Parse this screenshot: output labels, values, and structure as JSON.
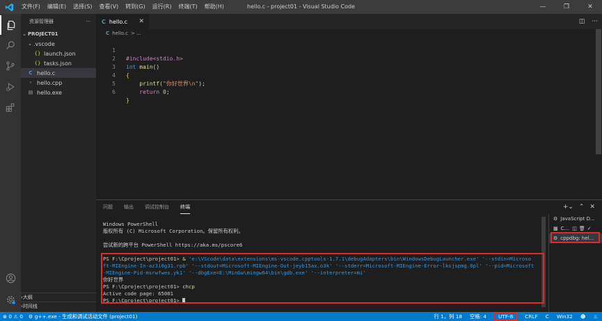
{
  "titlebar": {
    "title": "hello.c - project01 - Visual Studio Code",
    "menu": [
      "文件(F)",
      "编辑(E)",
      "选择(S)",
      "查看(V)",
      "转到(G)",
      "运行(R)",
      "终端(T)",
      "帮助(H)"
    ]
  },
  "activity": [
    "files-icon",
    "search-icon",
    "source-control-icon",
    "run-debug-icon",
    "extensions-icon",
    "account-icon",
    "settings-gear-icon"
  ],
  "explorer": {
    "header": "资源管理器",
    "more": "···",
    "project": "PROJECT01",
    "vscode_folder": ".vscode",
    "launch": "launch.json",
    "tasks": "tasks.json",
    "hello_c": "hello.c",
    "hello_cpp": "hello.cpp",
    "hello_exe": "hello.exe",
    "json_icon": "{}",
    "c_icon": "C",
    "outline": "大纲",
    "timeline": "时间线"
  },
  "editor": {
    "tab_icon": "C",
    "tab_label": "hello.c",
    "breadcrumb_icon": "C",
    "breadcrumb_file": "hello.c",
    "breadcrumb_sep": "> ...",
    "lines": {
      "l1": {
        "n": "1",
        "pre": "#include<stdio.h>"
      },
      "l2": {
        "n": "2",
        "kw": "int",
        "fn": "main",
        "rest": "()"
      },
      "l3": {
        "n": "3",
        "brace": "{"
      },
      "l4": {
        "n": "4",
        "fn": "printf",
        "open": "(",
        "str": "\"你好世界\\n\"",
        "close": ");"
      },
      "l5": {
        "n": "5",
        "kw": "return",
        "num": "0",
        "end": ";"
      },
      "l6": {
        "n": "6",
        "brace": "}"
      }
    }
  },
  "panel": {
    "tabs": [
      "问题",
      "输出",
      "调试控制台",
      "终端"
    ],
    "terminal": {
      "l1": "Windows PowerShell",
      "l2": "版权所有 (C) Microsoft Corporation。保留所有权利。",
      "l3": "尝试新的跨平台 PowerShell https://aka.ms/pscore6",
      "prompt": "PS F:\\Cproject\\project01> ",
      "amp": "&",
      "cmd_a": " 'e:\\VScode\\data\\extensions\\ms-vscode.cpptools-1.7.1\\debugAdapters\\bin\\WindowsDebugLauncher.exe' '--stdin=Microso",
      "cmd_b": "ft-MIEngine-In-az3i0g31.rpb' '--stdout=Microsoft-MIEngine-Out-jeyb15ax.o3k' '--stderr=Microsoft-MIEngine-Error-lksjspmg.0pl' '--pid=Microsoft",
      "cmd_c": "-MIEngine-Pid-msrwfwes.yk1' '--dbgExe=E:\\MinGw\\mingw64\\bin\\gdb.exe' '--interpreter=mi'",
      "output": "你好世界",
      "chcp": "chcp",
      "codepage": "Active code page: 65001"
    },
    "list": {
      "js": "JavaScript D...",
      "c": "C...",
      "cppdbg": "cppdbg: hel..."
    }
  },
  "statusbar": {
    "errors": "⊗ 0 ⚠ 0",
    "task": "g++.exe - 生成和调试活动文件 (project01)",
    "position": "行 1，列 18",
    "spaces": "空格: 4",
    "encoding": "UTF-8",
    "eol": "CRLF",
    "lang": "C",
    "platform": "Win32"
  }
}
